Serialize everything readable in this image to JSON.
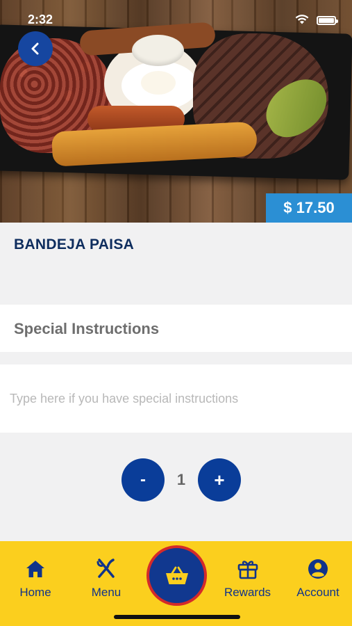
{
  "status_bar": {
    "time": "2:32"
  },
  "item": {
    "name": "BANDEJA PAISA",
    "price": "$ 17.50",
    "image_icon": "food-photo"
  },
  "special_instructions": {
    "label": "Special Instructions",
    "placeholder": "Type here if you have special instructions"
  },
  "quantity": {
    "minus_label": "-",
    "value": "1",
    "plus_label": "+"
  },
  "bottom_nav": {
    "items": [
      {
        "label": "Home",
        "icon": "home-icon"
      },
      {
        "label": "Menu",
        "icon": "utensils-icon"
      },
      {
        "label": "",
        "icon": "basket-icon"
      },
      {
        "label": "Rewards",
        "icon": "gift-icon"
      },
      {
        "label": "Account",
        "icon": "account-icon"
      }
    ]
  },
  "colors": {
    "brand_blue": "#0a3d99",
    "nav_yellow": "#fbcf1e",
    "price_blue": "#2b8fd4",
    "cart_ring_red": "#d42a2a"
  }
}
